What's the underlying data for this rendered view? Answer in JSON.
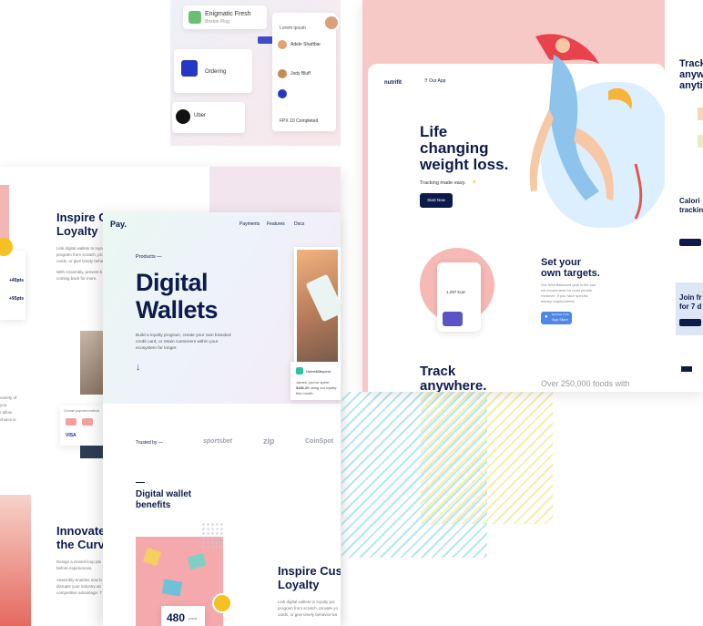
{
  "top_mockup": {
    "rows": [
      {
        "name": "Enigmatic Fresh",
        "sub": "Brixton Plug"
      },
      {
        "name": "Ordering",
        "sub": ""
      },
      {
        "name": "Uber",
        "sub": ""
      }
    ],
    "contacts": [
      "Lorem ipsum",
      "Adele Shaftbar",
      "Jody Bluff"
    ],
    "status": "FPX 10 Completed"
  },
  "back_left": {
    "heading": "Inspire C\nLoyalty",
    "para": "Link digital wallets to loyalty\nprogram from scratch, pro\ncards, or give timely beha",
    "para2": "With Assembly, prevent b\ncoming back for more.",
    "badge_top": "+40pts",
    "badge_bot": "+95pts",
    "side_text": "variety of\nyou\nr allow\nchoice is",
    "payment_label": "Choose payment method",
    "visa": "VISA",
    "heading2": "Innovate\nthe Curv",
    "para3": "Design a closed loop pla\nbefore experiences.",
    "para4": "Assembly enables new b\ndisrupts your industry an\ncompetitive advantage. T"
  },
  "pay": {
    "logo": "Pay.",
    "nav": [
      "Payments",
      "Features",
      "Docs"
    ],
    "kicker": "Products —",
    "title_line1": "Digital",
    "title_line2": "Wallets",
    "description": "Build a loyalty program, create your own branded\ncredit card, or retain customers within your\necosystem for longer.",
    "notif_merchant": "Home&Beyond",
    "notif_text1": "James, you've spent",
    "notif_amount": "$486.20",
    "notif_text2": " using our loyalty",
    "notif_text3": "this month.",
    "trusted": "Trusted by —",
    "logos": [
      "sportsbet",
      "zip",
      "CoinSpot"
    ],
    "benefits_title": "Digital wallet\nbenefits",
    "inspire": "Inspire Cus\nLoyalty",
    "inspire_para": "Link digital wallets to loyalty poi\nprogram from scratch, provide yo\ncards, or give timely behavior-ba",
    "counter": "480",
    "counter_sub": "points"
  },
  "nutrifit": {
    "logo": "nutrifit",
    "app_link": "Our App",
    "hero_line1": "Life",
    "hero_line2": "changing",
    "hero_line3": "weight loss.",
    "tagline": "Tracking made easy.",
    "cta": "Start Now",
    "phone_kcal": "1,297 kcal",
    "targets_title": "Set your\nown targets.",
    "targets_para": "Our Well Balanced goal is the one\nwe recommend for most people.\nHowever, if you have specific\ndietary requirements.",
    "store_small": "Download on the",
    "store": "App Store",
    "track": "Track\nanywhere.",
    "foods": "Over 250,000 foods with"
  },
  "right_edge": {
    "track": "Track\nanyw\nanyti",
    "calorie": "Calori\ntrackin",
    "join": "Join fr\nfor 7 d"
  },
  "colors": {
    "navy": "#0d1b4c",
    "pink": "#f4b6b4",
    "salmon": "#f09a97",
    "lightblue": "#dbeefa",
    "accent": "#3f4cc9"
  }
}
